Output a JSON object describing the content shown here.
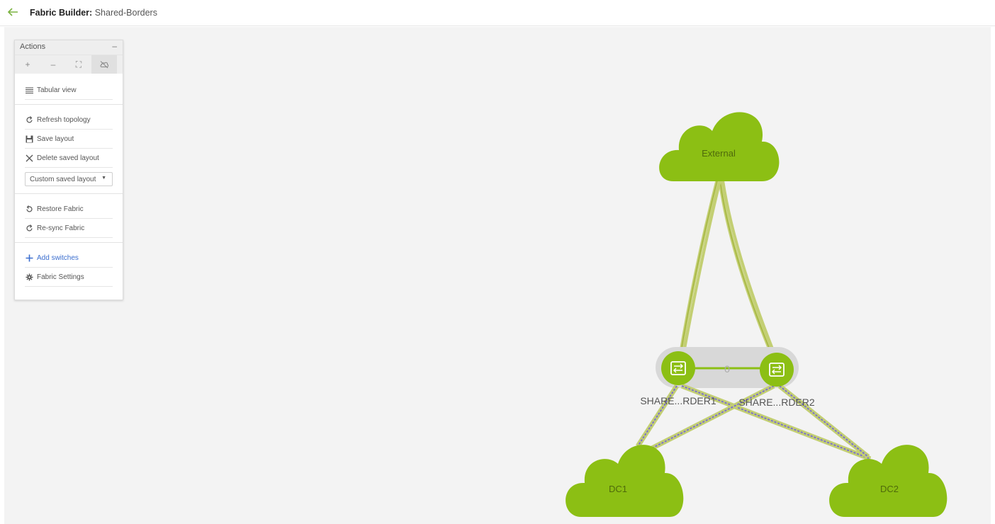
{
  "header": {
    "title_label": "Fabric Builder:",
    "title_name": "Shared-Borders"
  },
  "actions_panel": {
    "title": "Actions",
    "collapse_symbol": "–",
    "toolbar": {
      "zoom_in": "+",
      "zoom_out": "–",
      "fit": "⛶",
      "cloud": "cloud-off-icon"
    },
    "items": {
      "tabular_view": "Tabular view",
      "refresh_topology": "Refresh topology",
      "save_layout": "Save layout",
      "delete_saved_layout": "Delete saved layout",
      "layout_select": "Custom saved layout",
      "restore_fabric": "Restore Fabric",
      "resync_fabric": "Re-sync Fabric",
      "add_switches": "Add switches",
      "fabric_settings": "Fabric Settings"
    }
  },
  "topology": {
    "clouds": {
      "external": "External",
      "dc1": "DC1",
      "dc2": "DC2"
    },
    "switches": {
      "border1": "SHARE...RDER1",
      "border2": "SHARE...RDER2"
    },
    "vpc_label": "0",
    "colors": {
      "accent": "#8cbf14",
      "link": "#b7c85a",
      "link_dashed": "#7b6fd0",
      "group": "#d8d8d8"
    }
  }
}
